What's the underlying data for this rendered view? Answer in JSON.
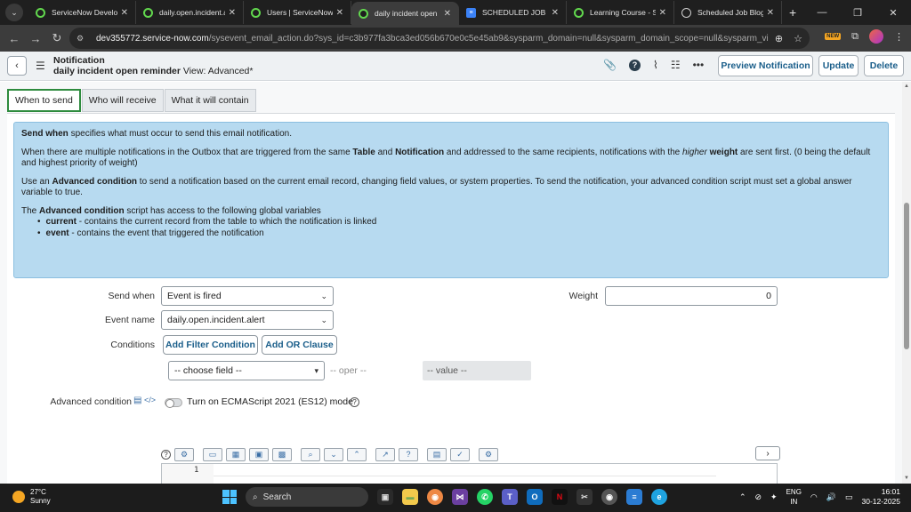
{
  "browser": {
    "tabs": [
      {
        "title": "ServiceNow Develop",
        "favicon": "servicenow-icon",
        "active": false
      },
      {
        "title": "daily.open.incident.al",
        "favicon": "servicenow-icon",
        "active": false
      },
      {
        "title": "Users | ServiceNow",
        "favicon": "servicenow-icon",
        "active": false
      },
      {
        "title": "daily incident open",
        "favicon": "servicenow-icon",
        "active": true
      },
      {
        "title": "SCHEDULED JOB",
        "favicon": "doc-icon",
        "active": false
      },
      {
        "title": "Learning Course - Se",
        "favicon": "servicenow-icon",
        "active": false
      },
      {
        "title": "Scheduled Job Blog",
        "favicon": "globe-icon",
        "active": false
      }
    ],
    "url_host": "dev355772.service-now.com",
    "url_path": "/sysevent_email_action.do?sys_id=c3b977fa3bca3ed056b670e0c5e45ab9&sysparm_domain=null&sysparm_domain_scope=null&sysparm_view=advance...",
    "new_badge": "NEW"
  },
  "header": {
    "record_type": "Notification",
    "record_name": "daily incident open reminder",
    "view_label": "View: Advanced*",
    "buttons": {
      "preview": "Preview Notification",
      "update": "Update",
      "delete": "Delete"
    }
  },
  "form_tabs": [
    "When to send",
    "Who will receive",
    "What it will contain"
  ],
  "info": {
    "p1_bold": "Send when",
    "p1_rest": " specifies what must occur to send this email notification.",
    "p2_a": "When there are multiple notifications in the Outbox that are triggered from the same ",
    "p2_table": "Table",
    "p2_b": " and ",
    "p2_notification": "Notification",
    "p2_c": " and addressed to the same recipients, notifications with the ",
    "p2_higher": "higher",
    "p2_weight": "weight",
    "p2_d": " are sent first. (0 being the default and highest priority of weight)",
    "p3_a": "Use an ",
    "p3_bold": "Advanced condition",
    "p3_b": " to send a notification based on the current email record, changing field values, or system properties. To send the notification, your advanced condition script must set a global answer variable to true.",
    "p4_a": "The ",
    "p4_bold": "Advanced condition",
    "p4_b": " script has access to the following global variables",
    "vars": [
      {
        "name": "current",
        "desc": " - contains the current record from the table to which the notification is linked"
      },
      {
        "name": "event",
        "desc": " - contains the event that triggered the notification"
      }
    ]
  },
  "fields": {
    "send_when_label": "Send when",
    "send_when_value": "Event is fired",
    "event_name_label": "Event name",
    "event_name_value": "daily.open.incident.alert",
    "weight_label": "Weight",
    "weight_value": "0",
    "conditions_label": "Conditions",
    "add_filter": "Add Filter Condition",
    "add_or": "Add OR Clause",
    "choose_field": "-- choose field --",
    "oper": "-- oper --",
    "value": "-- value --",
    "advanced_condition_label": "Advanced condition",
    "es_mode_label": "Turn on ECMAScript 2021 (ES12) mode"
  },
  "editor": {
    "line_number": "1"
  },
  "taskbar": {
    "temp": "27°C",
    "condition": "Sunny",
    "search_placeholder": "Search",
    "lang_top": "ENG",
    "lang_bottom": "IN",
    "time": "16:01",
    "date": "30-12-2025"
  }
}
